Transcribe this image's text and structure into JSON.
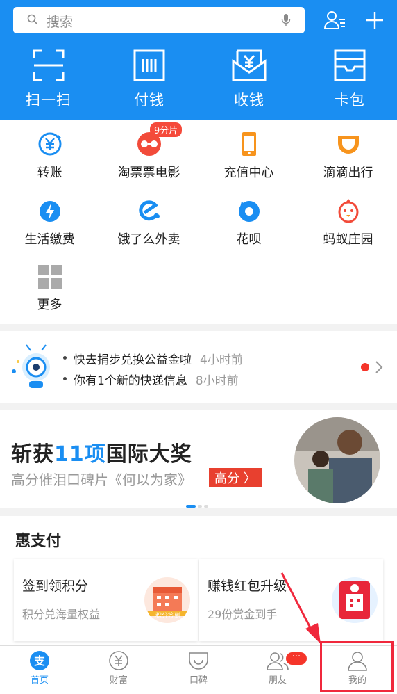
{
  "search": {
    "placeholder": "搜索"
  },
  "top_actions": [
    {
      "label": "扫一扫",
      "icon": "scan-icon"
    },
    {
      "label": "付钱",
      "icon": "pay-code-icon"
    },
    {
      "label": "收钱",
      "icon": "receive-money-icon"
    },
    {
      "label": "卡包",
      "icon": "card-wallet-icon"
    }
  ],
  "services": [
    {
      "label": "转账",
      "icon": "transfer-icon",
      "color": "#1a8ef2"
    },
    {
      "label": "淘票票电影",
      "icon": "movie-ticket-icon",
      "color": "#f24b3a",
      "badge": "9分片"
    },
    {
      "label": "充值中心",
      "icon": "phone-topup-icon",
      "color": "#f7941d"
    },
    {
      "label": "滴滴出行",
      "icon": "didi-icon",
      "color": "#f7941d"
    },
    {
      "label": "生活缴费",
      "icon": "utility-bill-icon",
      "color": "#1a8ef2"
    },
    {
      "label": "饿了么外卖",
      "icon": "eleme-icon",
      "color": "#1a8ef2"
    },
    {
      "label": "花呗",
      "icon": "huabei-icon",
      "color": "#1a8ef2"
    },
    {
      "label": "蚂蚁庄园",
      "icon": "ant-farm-icon",
      "color": "#f24b3a"
    },
    {
      "label": "更多",
      "icon": "more-grid-icon",
      "color": "#aaaaaa"
    }
  ],
  "news": [
    {
      "text": "快去捐步兑换公益金啦",
      "time": "4小时前"
    },
    {
      "text": "你有1个新的快递信息",
      "time": "8小时前"
    }
  ],
  "banner": {
    "title_a": "斩获",
    "title_hl": "11项",
    "title_b": "国际大奖",
    "subtitle": "高分催泪口碑片《何以为家》",
    "tag": "高分 〉"
  },
  "hui": {
    "title": "惠支付",
    "cards": [
      {
        "title": "签到领积分",
        "sub": "积分兑海量权益",
        "badge": "积分签到"
      },
      {
        "title": "赚钱红包升级",
        "sub": "29份赏金到手"
      }
    ]
  },
  "tabs": [
    {
      "label": "首页",
      "icon": "alipay-home-icon",
      "active": true
    },
    {
      "label": "财富",
      "icon": "wealth-icon"
    },
    {
      "label": "口碑",
      "icon": "koubei-icon"
    },
    {
      "label": "朋友",
      "icon": "friends-icon",
      "badge": "···"
    },
    {
      "label": "我的",
      "icon": "profile-icon"
    }
  ],
  "colors": {
    "brand": "#1a8ef2",
    "alert": "#f5352a",
    "highlight_box": "#f0283c"
  }
}
